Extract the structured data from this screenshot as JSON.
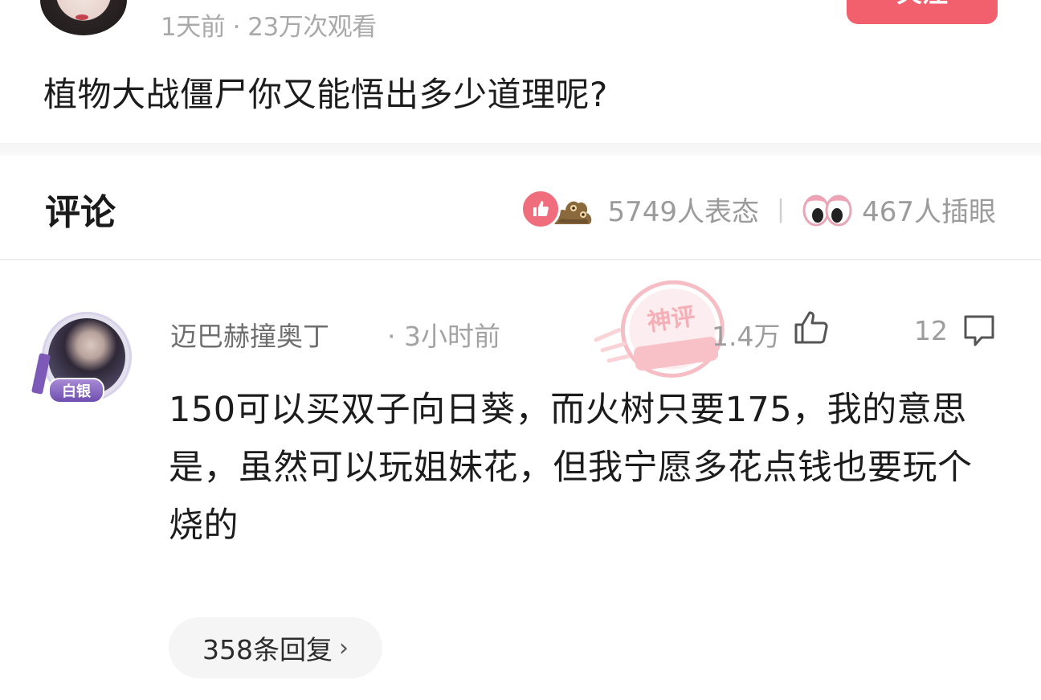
{
  "post": {
    "meta": "1天前 · 23万次观看",
    "follow_label": "关注",
    "title": "植物大战僵尸你又能悟出多少道理呢?"
  },
  "comments_section": {
    "heading": "评论",
    "reaction_count": "5749人表态",
    "eye_count": "467人插眼",
    "icons": [
      "like-reaction-icon",
      "poop-reaction-icon",
      "eyes-reaction-icon"
    ]
  },
  "comment": {
    "author": "迈巴赫撞奥丁",
    "time": "· 3小时前",
    "rank_badge": "白银",
    "likes": "1.4万",
    "replies": "12",
    "body": "150可以买双子向日葵，而火树只要175，我的意思是，虽然可以玩姐妹花，但我宁愿多花点钱也要玩个烧的",
    "replies_link": "358条回复",
    "watermark": "神评"
  },
  "colors": {
    "accent_pink": "#f2606d",
    "muted_text": "#9d9d9d",
    "rank_purple": "#7e5ab8"
  }
}
